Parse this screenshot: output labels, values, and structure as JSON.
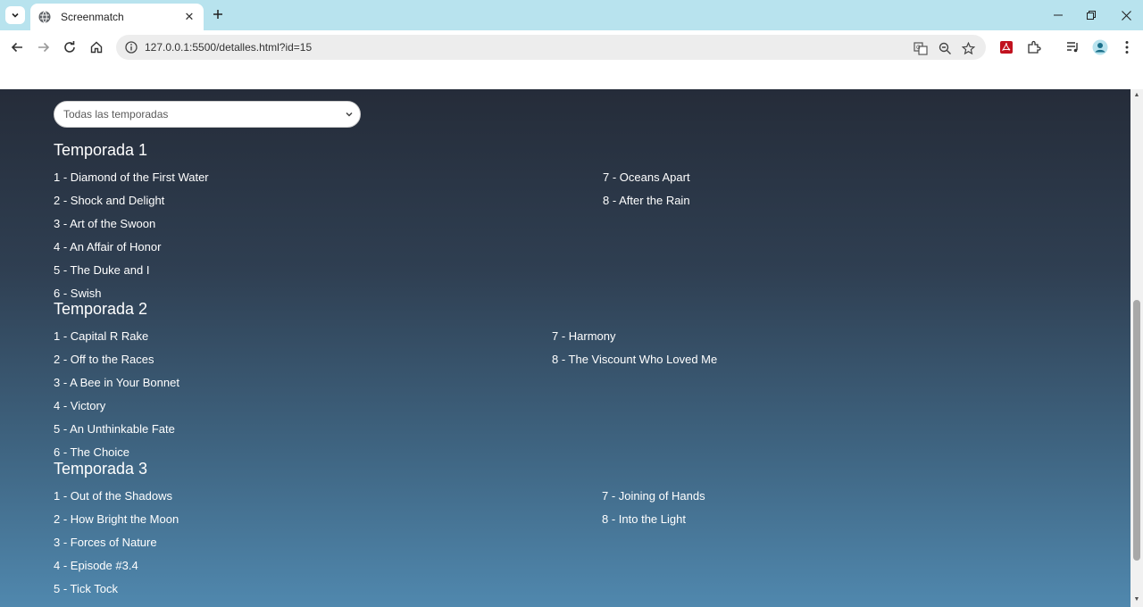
{
  "browser": {
    "tab_title": "Screenmatch",
    "url": "127.0.0.1:5500/detalles.html?id=15"
  },
  "filter": {
    "selected": "Todas las temporadas"
  },
  "seasons": [
    {
      "title": "Temporada 1",
      "episodes": [
        "1 - Diamond of the First Water",
        "2 - Shock and Delight",
        "3 - Art of the Swoon",
        "4 - An Affair of Honor",
        "5 - The Duke and I",
        "6 - Swish",
        "7 - Oceans Apart",
        "8 - After the Rain"
      ]
    },
    {
      "title": "Temporada 2",
      "episodes": [
        "1 - Capital R Rake",
        "2 - Off to the Races",
        "3 - A Bee in Your Bonnet",
        "4 - Victory",
        "5 - An Unthinkable Fate",
        "6 - The Choice",
        "7 - Harmony",
        "8 - The Viscount Who Loved Me"
      ]
    },
    {
      "title": "Temporada 3",
      "episodes": [
        "1 - Out of the Shadows",
        "2 - How Bright the Moon",
        "3 - Forces of Nature",
        "4 - Episode #3.4",
        "5 - Tick Tock",
        "7 - Joining of Hands",
        "8 - Into the Light"
      ]
    }
  ]
}
